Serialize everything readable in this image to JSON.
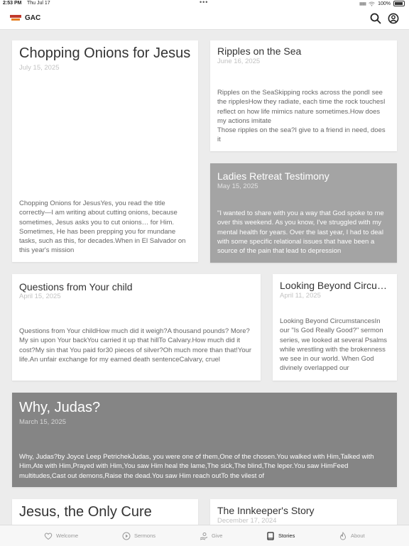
{
  "status_bar": {
    "time": "2:53 PM",
    "date": "Thu Jul 17",
    "battery": "100%"
  },
  "header": {
    "app_title": "GAC",
    "icons": [
      "search-icon",
      "account-icon"
    ]
  },
  "stories": [
    {
      "title": "Chopping Onions for Jesus",
      "date": "July 15, 2025",
      "excerpt": "Chopping Onions for JesusYes, you read the title correctly—I am writing about cutting onions, because sometimes, Jesus asks you to cut onions… for Him. Sometimes, He has been prepping you for mundane tasks, such as this, for decades.When in El Salvador on this year's mission"
    },
    {
      "title": "Ripples on the Sea",
      "date": "June 16, 2025",
      "excerpt": "Ripples on the SeaSkipping rocks across the pondI see the ripplesHow they radiate, each time the rock touchesI reflect on how life mimics nature sometimes.How does my actions imitate\nThose ripples on the sea?I give to a friend in need, does it"
    },
    {
      "title": "Ladies Retreat Testimony",
      "date": "May 15, 2025",
      "excerpt": "\"I wanted to share with you a way that God spoke to me over this weekend. As you know, I've struggled with my mental health for years. Over the last year, I had to deal with some specific relational issues that have been a source of the pain that lead to depression"
    },
    {
      "title": "Questions from Your child",
      "date": "April 15, 2025",
      "excerpt": "Questions from Your childHow much did it weigh?A thousand pounds? More?My sin upon Your backYou carried it up that hillTo Calvary.How much did it cost?My sin that You paid for30 pieces of silver?Oh much more than that!Your life.An unfair exchange for my earned death sentenceCalvary, cruel"
    },
    {
      "title": "Looking Beyond Circum...",
      "date": "April 11, 2025",
      "excerpt": "Looking Beyond CircumstancesIn our \"Is God Really Good?\" sermon series, we looked at several Psalms while wrestling with the brokenness we see in our world. When God divinely overlapped our"
    },
    {
      "title": "Why, Judas?",
      "date": "March 15, 2025",
      "excerpt": "Why, Judas?by Joyce Leep PetrichekJudas, you were one of them,One of the chosen.You walked with Him,Talked with Him,Ate with Him,Prayed with Him,You saw Him heal the lame,The sick,The blind,The leper.You saw HimFeed multitudes,Cast out demons,Raise the dead.You saw Him reach outTo the vilest of"
    },
    {
      "title": "Jesus, the Only Cure",
      "date": "",
      "excerpt": ""
    },
    {
      "title": "The Innkeeper's Story",
      "date": "December 17, 2024",
      "excerpt": ""
    }
  ],
  "tab_bar": {
    "tabs": [
      {
        "label": "Welcome",
        "icon": "heart-icon",
        "active": false
      },
      {
        "label": "Sermons",
        "icon": "play-icon",
        "active": false
      },
      {
        "label": "Give",
        "icon": "give-icon",
        "active": false
      },
      {
        "label": "Stories",
        "icon": "book-icon",
        "active": true
      },
      {
        "label": "About",
        "icon": "flame-icon",
        "active": false
      }
    ]
  },
  "colors": {
    "accent": "#222222",
    "inactive_tab": "#999999",
    "card_gray": "#a4a4a4",
    "card_dark": "#858585"
  }
}
